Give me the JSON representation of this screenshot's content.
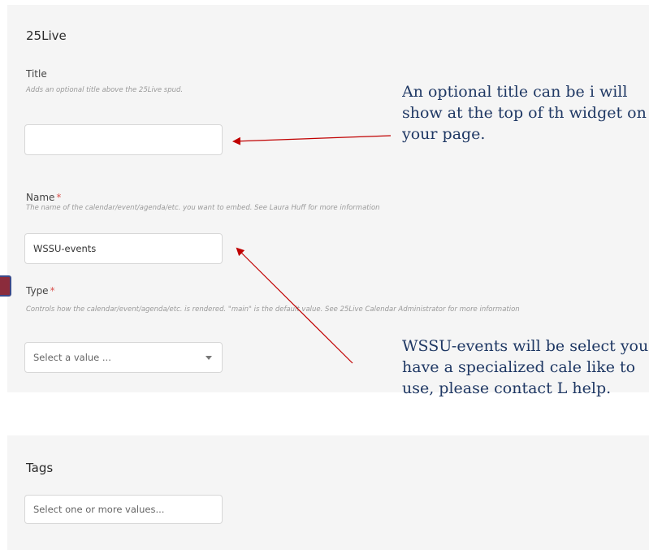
{
  "section": {
    "title": "25Live"
  },
  "fields": {
    "title": {
      "label": "Title",
      "help": "Adds an optional title above the 25Live spud.",
      "value": ""
    },
    "name": {
      "label": "Name",
      "required_mark": "*",
      "help": "The name of the calendar/event/agenda/etc. you want to embed. See Laura Huff for more information",
      "value": "WSSU-events"
    },
    "type": {
      "label": "Type",
      "required_mark": "*",
      "help": "Controls how the calendar/event/agenda/etc. is rendered. \"main\" is the default value. See 25Live Calendar Administrator for more information",
      "placeholder": "Select a value ..."
    }
  },
  "tags": {
    "title": "Tags",
    "placeholder": "Select one or more values..."
  },
  "annotations": {
    "title_note": "An optional title can be i will show at the top of th widget on your page.",
    "name_note": "WSSU-events will be select you have a specialized cale like to use, please contact L help."
  },
  "colors": {
    "arrow": "#c00000",
    "annotation_text": "#1f3864",
    "required": "#d9534f",
    "panel_bg": "#f5f5f5"
  }
}
